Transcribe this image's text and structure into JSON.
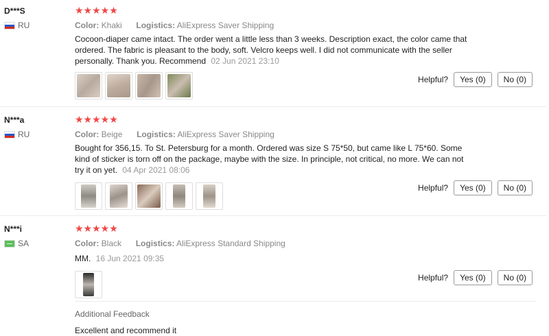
{
  "reviews": [
    {
      "user": "D***S",
      "country": "RU",
      "flag_color": "ru",
      "stars": "★★★★★",
      "color_label": "Color:",
      "color_value": "Khaki",
      "logistics_label": "Logistics:",
      "logistics_value": "AliExpress Saver Shipping",
      "text": "Cocoon-diaper came intact. The order went a little less than 3 weeks. Description exact, the color came that ordered. The fabric is pleasant to the body, soft. Velcro keeps well. I did not communicate with the seller personally. Thank you. Recommend",
      "date": "02 Jun 2021 23:10",
      "helpful_label": "Helpful?",
      "yes_label": "Yes (0)",
      "no_label": "No (0)"
    },
    {
      "user": "N***a",
      "country": "RU",
      "flag_color": "ru",
      "stars": "★★★★★",
      "color_label": "Color:",
      "color_value": "Beige",
      "logistics_label": "Logistics:",
      "logistics_value": "AliExpress Saver Shipping",
      "text": "Bought for 356,15. To St. Petersburg for a month. Ordered was size S 75*50, but came like L 75*60. Some kind of sticker is torn off on the package, maybe with the size. In principle, not critical, no more. We can not try it on yet.",
      "date": "04 Apr 2021 08:06",
      "helpful_label": "Helpful?",
      "yes_label": "Yes (0)",
      "no_label": "No (0)"
    },
    {
      "user": "N***i",
      "country": "SA",
      "flag_color": "sa",
      "stars": "★★★★★",
      "color_label": "Color:",
      "color_value": "Black",
      "logistics_label": "Logistics:",
      "logistics_value": "AliExpress Standard Shipping",
      "text": "MM.",
      "date": "16 Jun 2021 09:35",
      "helpful_label": "Helpful?",
      "yes_label": "Yes (0)",
      "no_label": "No (0)",
      "additional_title": "Additional Feedback",
      "additional_text": "Excellent and recommend it"
    }
  ],
  "colors": {
    "star": "#f04848",
    "divider": "#ececec",
    "meta_text": "#888888"
  }
}
